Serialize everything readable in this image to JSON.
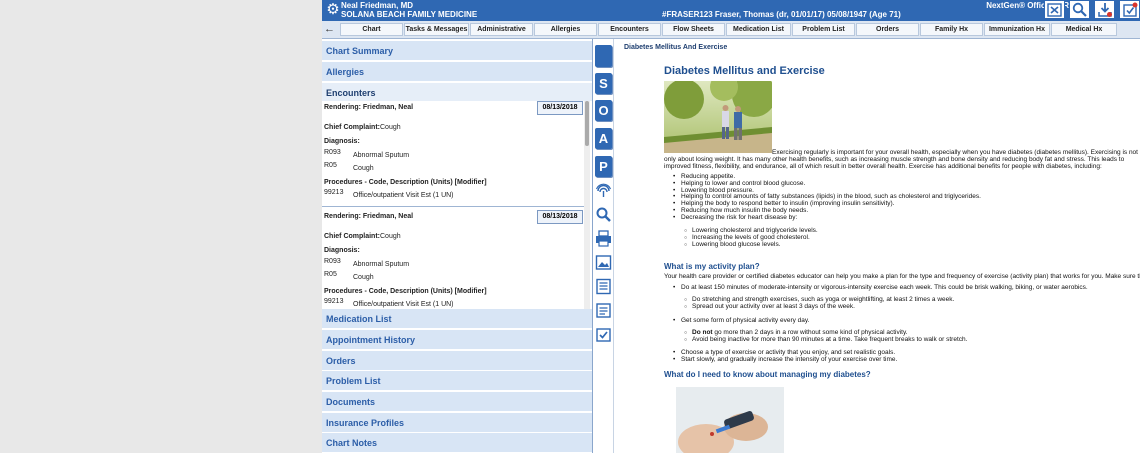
{
  "header": {
    "provider": "Neal Friedman, MD",
    "practice": "SOLANA BEACH FAMILY MEDICINE",
    "ehr": "NextGen® Office EHR",
    "patient_line": "#FRASER123     Fraser, Thomas (dr, 01/01/17)     05/08/1947     (Age 71)"
  },
  "tabs": [
    "Chart",
    "Tasks & Messages",
    "Administrative",
    "Allergies",
    "Encounters",
    "Flow Sheets",
    "Medication List",
    "Problem List",
    "Orders",
    "Family Hx",
    "Immunization Hx",
    "Medical Hx"
  ],
  "left": {
    "sections_top": [
      "Chart Summary",
      "Allergies",
      "Encounters"
    ],
    "sections_bottom": [
      "Medication List",
      "Appointment History",
      "Orders",
      "Problem List",
      "Documents",
      "Insurance Profiles",
      "Chart Notes"
    ],
    "encounters": [
      {
        "rendering": "Rendering:  Friedman, Neal",
        "date": "08/13/2018",
        "cc_label": "Chief Complaint:",
        "cc": "Cough",
        "dx_label": "Diagnosis:",
        "dx": [
          {
            "code": "R093",
            "desc": "Abnormal Sputum"
          },
          {
            "code": "R05",
            "desc": "Cough"
          }
        ],
        "proc_label": "Procedures - Code, Description (Units) [Modifier]",
        "proc": {
          "code": "99213",
          "desc": "Office/outpatient Visit Est (1 UN)"
        }
      },
      {
        "rendering": "Rendering:  Friedman, Neal",
        "date": "08/13/2018",
        "cc_label": "Chief Complaint:",
        "cc": "Cough",
        "dx_label": "Diagnosis:",
        "dx": [
          {
            "code": "R093",
            "desc": "Abnormal Sputum"
          },
          {
            "code": "R05",
            "desc": "Cough"
          }
        ],
        "proc_label": "Procedures - Code, Description (Units) [Modifier]",
        "proc": {
          "code": "99213",
          "desc": "Office/outpatient Visit Est (1 UN)"
        }
      }
    ]
  },
  "soap": [
    "S",
    "O",
    "A",
    "P"
  ],
  "icons": [
    "close-icon",
    "search-icon",
    "download-icon",
    "checklist-icon",
    "gear-icon",
    "back-arrow-icon",
    "fingerprint-icon",
    "magnifier-icon",
    "printer-icon",
    "image-icon",
    "document-icon",
    "note-icon",
    "checkbox-icon"
  ],
  "content": {
    "breadcrumb": "Diabetes Mellitus And Exercise",
    "title": "Diabetes Mellitus and Exercise",
    "intro": "Exercising regularly is important for your overall health, especially when you have diabetes (diabetes mellitus). Exercising is not only about losing weight. It has many other health benefits, such as increasing muscle strength and bone density and reducing body fat and stress. This leads to improved fitness, flexibility, and endurance, all of which result in better overall health. Exercise has additional benefits for people with diabetes, including:",
    "benefits": [
      "Reducing appetite.",
      "Helping to lower and control blood glucose.",
      "Lowering blood pressure.",
      "Helping to control amounts of fatty substances (lipids) in the blood, such as cholesterol and triglycerides.",
      "Helping the body to respond better to insulin (improving insulin sensitivity).",
      "Reducing how much insulin the body needs.",
      "Decreasing the risk for heart disease by:"
    ],
    "heart": [
      "Lowering cholesterol and triglyceride levels.",
      "Increasing the levels of good cholesterol.",
      "Lowering blood glucose levels."
    ],
    "plan_heading": "What is my activity plan?",
    "plan_intro": "Your health care provider or certified diabetes educator can help you make a plan for the type and frequency of exercise (activity plan) that works for you. Make sure that you:",
    "plan1": "Do at least 150 minutes of moderate-intensity or vigorous-intensity exercise each week. This could be brisk walking, biking, or water aerobics.",
    "plan1_sub": [
      "Do stretching and strength exercises, such as yoga or weightlifting, at least 2 times a week.",
      "Spread out your activity over at least 3 days of the week."
    ],
    "plan2": "Get some form of physical activity every day.",
    "plan2_sub_bold": "Do not",
    "plan2_sub_rest": " go more than 2 days in a row without some kind of physical activity.",
    "plan2_sub2": "Avoid being inactive for more than 90 minutes at a time. Take frequent breaks to walk or stretch.",
    "plan3": [
      "Choose a type of exercise or activity that you enjoy, and set realistic goals.",
      "Start slowly, and gradually increase the intensity of your exercise over time."
    ],
    "manage_heading": "What do I need to know about managing my diabetes?"
  }
}
